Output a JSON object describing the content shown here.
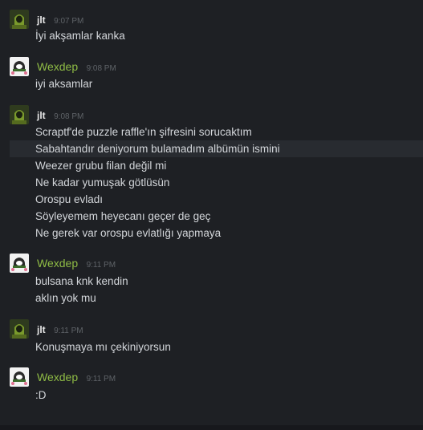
{
  "messages": [
    {
      "author": "jlt",
      "time": "9:07 PM",
      "lines": [
        "İyi akşamlar kanka"
      ]
    },
    {
      "author": "Wexdep",
      "time": "9:08 PM",
      "lines": [
        "iyi aksamlar"
      ]
    },
    {
      "author": "jlt",
      "time": "9:08 PM",
      "lines": [
        "Scraptf'de puzzle raffle'ın şifresini sorucaktım",
        "Sabahtandır deniyorum bulamadım albümün ismini",
        "Weezer grubu filan değil mi",
        "Ne kadar yumuşak götlüsün",
        "Orospu evladı",
        "Söyleyemem heyecanı geçer de geç",
        "Ne gerek var orospu evlatlığı yapmaya"
      ]
    },
    {
      "author": "Wexdep",
      "time": "9:11 PM",
      "lines": [
        "bulsana knk kendin",
        "aklın yok mu"
      ]
    },
    {
      "author": "jlt",
      "time": "9:11 PM",
      "lines": [
        "Konuşmaya mı çekiniyorsun"
      ]
    },
    {
      "author": "Wexdep",
      "time": "9:11 PM",
      "lines": [
        ":D"
      ]
    }
  ],
  "colors": {
    "background": "#1e2024",
    "wexdep_name": "#8fbc45",
    "jlt_name": "#e8e8e8",
    "message_text": "#d3d6da",
    "timestamp": "#5f6368"
  },
  "icons": {
    "jlt_avatar": "green-hooded-figure-icon",
    "wexdep_avatar": "white-creature-icon"
  }
}
